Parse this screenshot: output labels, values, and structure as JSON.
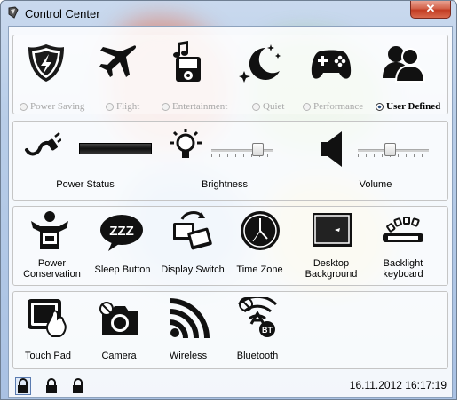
{
  "window": {
    "title": "Control Center",
    "close_label": "✕"
  },
  "modes": [
    {
      "label": "Power Saving",
      "selected": false,
      "icon": "power-saving-shield-icon"
    },
    {
      "label": "Flight",
      "selected": false,
      "icon": "airplane-icon"
    },
    {
      "label": "Entertainment",
      "selected": false,
      "icon": "music-player-icon"
    },
    {
      "label": "Quiet",
      "selected": false,
      "icon": "moon-stars-icon"
    },
    {
      "label": "Performance",
      "selected": false,
      "icon": "gamepad-icon"
    },
    {
      "label": "User Defined",
      "selected": true,
      "icon": "users-icon"
    }
  ],
  "status_row": {
    "power_status": "Power Status",
    "brightness": "Brightness",
    "volume": "Volume",
    "brightness_level": 0.8,
    "volume_level": 0.45
  },
  "tools_row": [
    {
      "label": "Power Conservation",
      "icon": "power-conservation-icon"
    },
    {
      "label": "Sleep Button",
      "icon": "sleep-zzz-icon"
    },
    {
      "label": "Display Switch",
      "icon": "display-switch-icon"
    },
    {
      "label": "Time Zone",
      "icon": "clock-icon"
    },
    {
      "label": "Desktop Background",
      "icon": "desktop-background-icon"
    },
    {
      "label": "Backlight keyboard",
      "icon": "backlight-keyboard-icon"
    }
  ],
  "devices_row": [
    {
      "label": "Touch Pad",
      "icon": "touchpad-icon"
    },
    {
      "label": "Camera",
      "icon": "camera-icon"
    },
    {
      "label": "Wireless",
      "icon": "wireless-icon"
    },
    {
      "label": "Bluetooth",
      "icon": "bluetooth-icon"
    }
  ],
  "statusbar": {
    "datetime": "16.11.2012 16:17:19"
  }
}
